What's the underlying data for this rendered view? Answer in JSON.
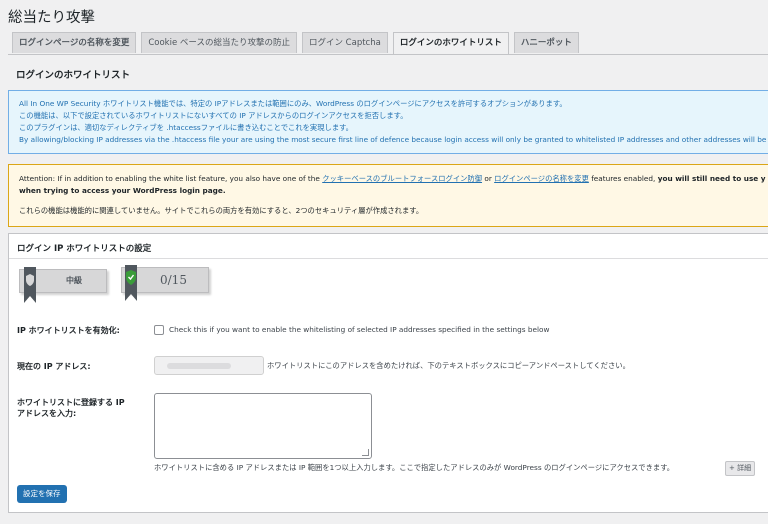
{
  "page_title": "総当たり攻撃",
  "tabs": [
    {
      "label": "ログインページの名称を変更"
    },
    {
      "label": "Cookie ベースの総当たり攻撃の防止"
    },
    {
      "label": "ログイン Captcha"
    },
    {
      "label": "ログインのホワイトリスト"
    },
    {
      "label": "ハニーポット"
    }
  ],
  "section_title": "ログインのホワイトリスト",
  "info_box": {
    "line1": "All In One WP Security ホワイトリスト機能では、特定の IPアドレスまたは範囲にのみ、WordPress のログインページにアクセスを許可するオプションがあります。",
    "line2": "この機能は、以下で設定されているホワイトリストにないすべての IP アドレスからのログインアクセスを拒否します。",
    "line3": "このプラグインは、適切なディレクティブを .htaccessファイルに書き込むことでこれを実現します。",
    "line4": "By allowing/blocking IP addresses via the .htaccess file your are using the most secure first line of defence because login access will only be granted to whitelisted IP addresses and other addresses will be blocked"
  },
  "warning_box": {
    "prefix": "Attention: If in addition to enabling the white list feature, you also have one of the",
    "link1": "クッキーベースのブルートフォースログイン防御",
    "or": "or",
    "link2": "ログインページの名称を変更",
    "suffix": "features enabled,",
    "bold1": "you will still need to use y",
    "bold2": "when trying to access your WordPress login page.",
    "note": "これらの機能は機能的に関連していません。サイトでこれらの両方を有効にすると、2つのセキュリティ層が作成されます。"
  },
  "panel": {
    "title": "ログイン IP ホワイトリストの設定",
    "badge_level": "中級",
    "badge_points": "0/15",
    "enable_label": "IP ホワイトリストを有効化:",
    "enable_desc": "Check this if you want to enable the whitelisting of selected IP addresses specified in the settings below",
    "current_ip_label": "現在の IP アドレス:",
    "current_ip_desc": "ホワイトリストにこのアドレスを含めたければ、下のテキストボックスにコピーアンドペーストしてください。",
    "whitelist_label_1": "ホワイトリストに登録する IP",
    "whitelist_label_2": "アドレスを入力:",
    "whitelist_desc": "ホワイトリストに含める IP アドレスまたは IP 範囲を1つ以上入力します。ここで指定したアドレスのみが WordPress のログインページにアクセスできます。",
    "more_label": "+ 詳細",
    "save_label": "設定を保存"
  },
  "colors": {
    "primary": "#2271b1",
    "info_bg": "#e6f5fc",
    "warning_bg": "#fff8e5",
    "warning_border": "#dba617",
    "shield_green": "#3a9d3a"
  }
}
